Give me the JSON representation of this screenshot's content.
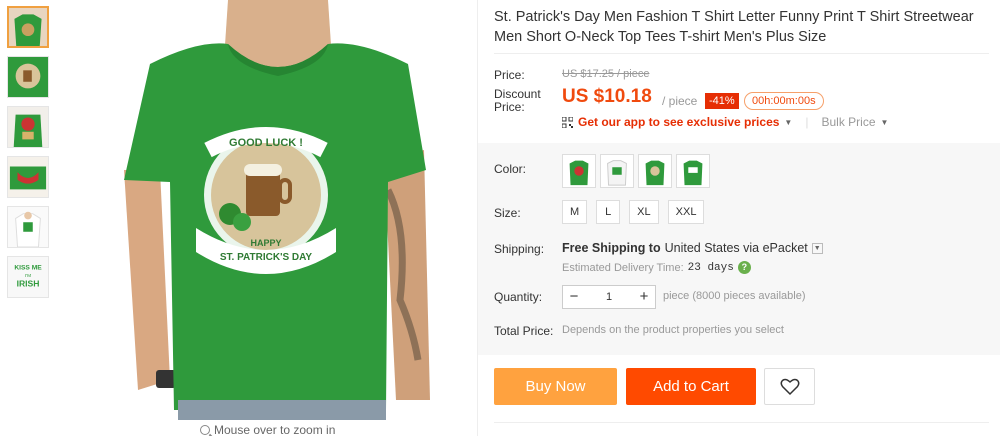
{
  "product": {
    "title": "St. Patrick's Day Men Fashion T Shirt Letter Funny Print T Shirt Streetwear Men Short O-Neck Top Tees T-shirt Men's Plus Size"
  },
  "gallery": {
    "thumbnails": [
      {
        "name": "thumb-green-beer-shirt"
      },
      {
        "name": "thumb-green-beer-print"
      },
      {
        "name": "thumb-green-shirt-back"
      },
      {
        "name": "thumb-green-shirt-fold"
      },
      {
        "name": "thumb-white-shirt"
      },
      {
        "name": "thumb-kiss-me-irish",
        "text": "KISS ME I'M IRISH"
      }
    ],
    "main_print": {
      "top_text": "GOOD LUCK !",
      "bottom_line1": "HAPPY",
      "bottom_line2": "ST. PATRICK'S DAY"
    },
    "zoom_hint": "Mouse over to zoom in"
  },
  "price": {
    "label": "Price:",
    "original": "US $17.25 / piece",
    "discount_label": "Discount Price:",
    "discount_value": "US $10.18",
    "per_piece": "/ piece",
    "off_badge": "-41%",
    "timer": "00h:00m:00s",
    "app_link": "Get our app to see exclusive prices",
    "bulk_price": "Bulk Price"
  },
  "options": {
    "color_label": "Color:",
    "size_label": "Size:",
    "sizes": [
      "M",
      "L",
      "XL",
      "XXL"
    ],
    "shipping_label": "Shipping:",
    "shipping_free": "Free Shipping to",
    "shipping_dest": "United States via ePacket",
    "est_delivery_label": "Estimated Delivery Time:",
    "est_delivery_value": "23 days",
    "quantity_label": "Quantity:",
    "quantity_value": "1",
    "quantity_avail": "piece (8000 pieces available)",
    "total_label": "Total Price:",
    "total_text": "Depends on the product properties you select"
  },
  "actions": {
    "buy_now": "Buy Now",
    "add_to_cart": "Add to Cart"
  },
  "colors": {
    "shirt_green": "#2f9a3c",
    "discount_red": "#f04a0e",
    "buy_orange": "#ffa23f",
    "cart_orange": "#ff4a00"
  }
}
